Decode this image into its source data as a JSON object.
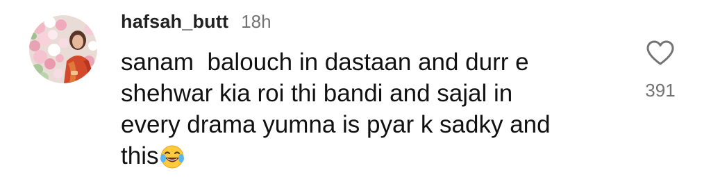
{
  "comment": {
    "username": "hafsah_butt",
    "timestamp": "18h",
    "lines": [
      "sanam  balouch in dastaan and durr e",
      "shehwar kia roi thi bandi and sajal in",
      "every drama yumna is pyar k sadky and",
      "this"
    ],
    "emoji": "face-with-tears-of-joy-icon",
    "like_icon": "heart-outline-icon",
    "like_count": "391"
  },
  "colors": {
    "text": "#111111",
    "muted": "#737373",
    "background": "#ffffff"
  }
}
